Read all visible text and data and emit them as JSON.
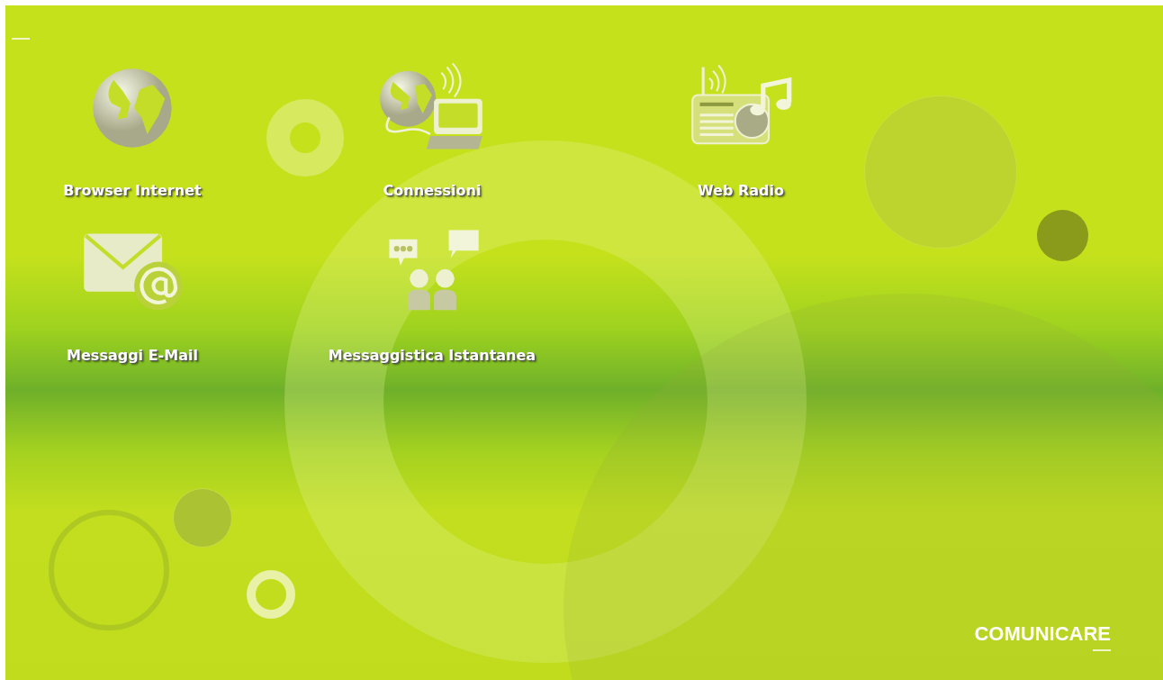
{
  "launchers": [
    {
      "kind": "globe",
      "label": "Browser Internet"
    },
    {
      "kind": "globe-laptop",
      "label": "Connessioni"
    },
    {
      "kind": "radio",
      "label": "Web Radio"
    },
    {
      "kind": "mail",
      "label": "Messaggi E-Mail"
    },
    {
      "kind": "chat",
      "label": "Messaggistica Istantanea"
    }
  ],
  "section_title": "COMUNICARE"
}
